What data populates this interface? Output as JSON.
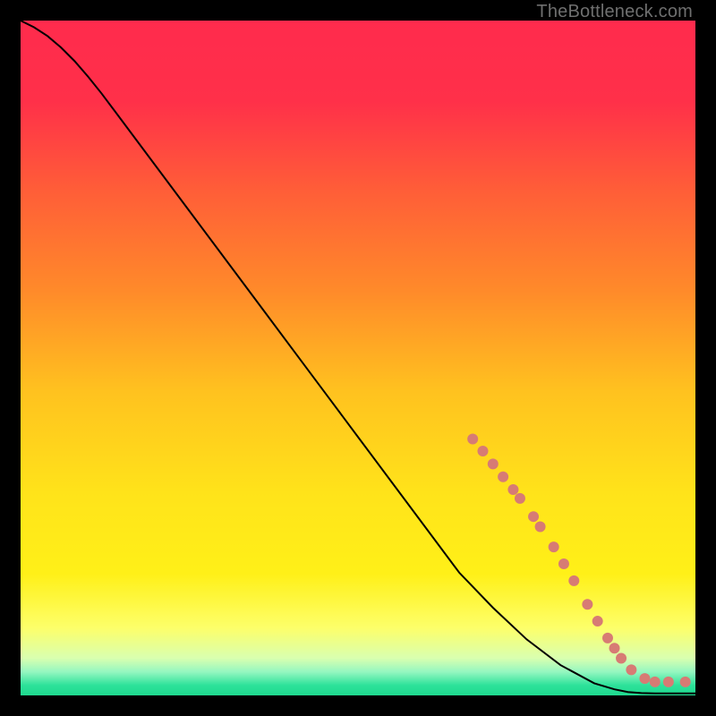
{
  "watermark": "TheBottleneck.com",
  "chart_data": {
    "type": "line",
    "title": "",
    "xlabel": "",
    "ylabel": "",
    "xlim": [
      0,
      100
    ],
    "ylim": [
      0,
      100
    ],
    "grid": false,
    "background_gradient": {
      "stops": [
        {
          "pos": 0.0,
          "color": "#ff2b4d"
        },
        {
          "pos": 0.12,
          "color": "#ff3049"
        },
        {
          "pos": 0.25,
          "color": "#ff5d38"
        },
        {
          "pos": 0.4,
          "color": "#ff8a2a"
        },
        {
          "pos": 0.55,
          "color": "#ffc21f"
        },
        {
          "pos": 0.7,
          "color": "#ffe31a"
        },
        {
          "pos": 0.82,
          "color": "#fff018"
        },
        {
          "pos": 0.9,
          "color": "#fdff6a"
        },
        {
          "pos": 0.945,
          "color": "#d9ffb0"
        },
        {
          "pos": 0.965,
          "color": "#95f7c0"
        },
        {
          "pos": 0.985,
          "color": "#2de29a"
        },
        {
          "pos": 1.0,
          "color": "#1fd98f"
        }
      ]
    },
    "series": [
      {
        "name": "curve",
        "stroke": "#000000",
        "stroke_width": 2,
        "x": [
          0,
          2,
          4,
          6,
          8,
          10,
          12,
          15,
          20,
          25,
          30,
          35,
          40,
          45,
          50,
          55,
          60,
          65,
          70,
          75,
          80,
          85,
          88,
          90,
          92,
          94,
          96,
          98,
          100
        ],
        "y": [
          100,
          99.0,
          97.7,
          96.0,
          94.0,
          91.7,
          89.2,
          85.2,
          78.5,
          71.8,
          65.1,
          58.4,
          51.7,
          45.0,
          38.3,
          31.6,
          24.9,
          18.2,
          13.0,
          8.3,
          4.5,
          1.8,
          0.9,
          0.5,
          0.35,
          0.3,
          0.3,
          0.3,
          0.3
        ]
      }
    ],
    "markers": {
      "name": "dotted-segment",
      "color": "#d77b74",
      "radius": 6,
      "points": [
        {
          "x": 67.0,
          "y": 38.0
        },
        {
          "x": 68.5,
          "y": 36.2
        },
        {
          "x": 70.0,
          "y": 34.3
        },
        {
          "x": 71.5,
          "y": 32.4
        },
        {
          "x": 73.0,
          "y": 30.5
        },
        {
          "x": 74.0,
          "y": 29.2
        },
        {
          "x": 76.0,
          "y": 26.5
        },
        {
          "x": 77.0,
          "y": 25.0
        },
        {
          "x": 79.0,
          "y": 22.0
        },
        {
          "x": 80.5,
          "y": 19.5
        },
        {
          "x": 82.0,
          "y": 17.0
        },
        {
          "x": 84.0,
          "y": 13.5
        },
        {
          "x": 85.5,
          "y": 11.0
        },
        {
          "x": 87.0,
          "y": 8.5
        },
        {
          "x": 88.0,
          "y": 7.0
        },
        {
          "x": 89.0,
          "y": 5.5
        },
        {
          "x": 90.5,
          "y": 3.8
        },
        {
          "x": 92.5,
          "y": 2.5
        },
        {
          "x": 94.0,
          "y": 2.0
        },
        {
          "x": 96.0,
          "y": 2.0
        },
        {
          "x": 98.5,
          "y": 2.0
        }
      ]
    }
  }
}
